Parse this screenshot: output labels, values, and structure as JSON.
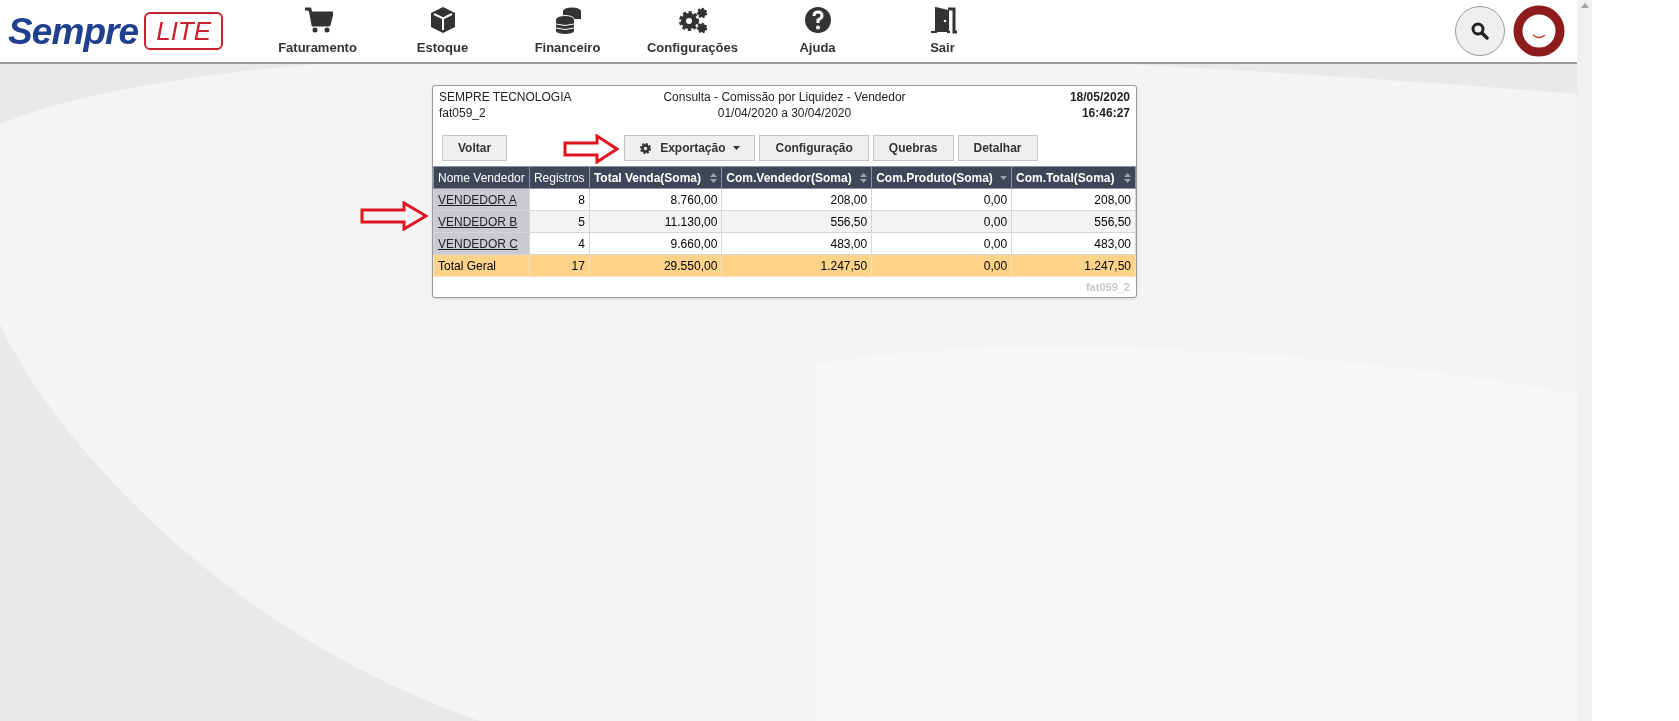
{
  "logo": {
    "brand": "Sempre",
    "edition": "LITE"
  },
  "nav": [
    {
      "label": "Faturamento"
    },
    {
      "label": "Estoque"
    },
    {
      "label": "Financeiro"
    },
    {
      "label": "Configurações"
    },
    {
      "label": "Ajuda"
    },
    {
      "label": "Sair"
    }
  ],
  "report": {
    "company": "SEMPRE TECNOLOGIA",
    "code": "fat059_2",
    "title": "Consulta - Comissão por Liquidez - Vendedor",
    "period": "01/04/2020 a 30/04/2020",
    "date": "18/05/2020",
    "time": "16:46:27",
    "footer_code": "fat059_2"
  },
  "toolbar": [
    {
      "label": "Voltar",
      "kind": "plain"
    },
    {
      "label": "Exportação",
      "kind": "menu"
    },
    {
      "label": "Configuração",
      "kind": "plain"
    },
    {
      "label": "Quebras",
      "kind": "plain"
    },
    {
      "label": "Detalhar",
      "kind": "plain"
    }
  ],
  "table": {
    "columns": [
      {
        "label": "Nome Vendedor",
        "kind": "plain"
      },
      {
        "label": "Registros",
        "kind": "plain"
      },
      {
        "label": "Total Venda(Soma)",
        "kind": "sortable"
      },
      {
        "label": "Com.Vendedor(Soma)",
        "kind": "sortable"
      },
      {
        "label": "Com.Produto(Soma)",
        "kind": "descending"
      },
      {
        "label": "Com.Total(Soma)",
        "kind": "sortable"
      }
    ],
    "rows": [
      [
        "VENDEDOR A",
        "8",
        "8.760,00",
        "208,00",
        "0,00",
        "208,00"
      ],
      [
        "VENDEDOR B",
        "5",
        "11.130,00",
        "556,50",
        "0,00",
        "556,50"
      ],
      [
        "VENDEDOR C",
        "4",
        "9.660,00",
        "483,00",
        "0,00",
        "483,00"
      ]
    ],
    "total": [
      "Total Geral",
      "17",
      "29.550,00",
      "1.247,50",
      "0,00",
      "1.247,50"
    ]
  }
}
